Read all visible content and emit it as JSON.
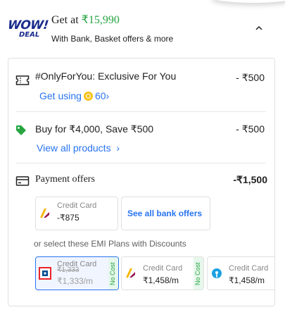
{
  "header": {
    "logo_wow": "WOW!",
    "logo_deal": "DEAL",
    "get_at_label": "Get at",
    "get_at_price": "₹15,990",
    "subtitle": "With Bank, Basket offers & more"
  },
  "offers": {
    "exclusive": {
      "title": "#OnlyForYou: Exclusive For You",
      "amount": "- ₹500",
      "link_label": "Get using",
      "coins": "60",
      "link_chevron": "›"
    },
    "basket": {
      "title": "Buy for ₹4,000, Save ₹500",
      "amount": "- ₹500",
      "link_label": "View all products",
      "link_chevron": "›"
    },
    "payment": {
      "title": "Payment offers",
      "amount": "-₹1,500",
      "bank_offer": {
        "type": "Credit Card",
        "value": "-₹875"
      },
      "see_all_label": "See all bank offers",
      "emi_hint": "or select these EMI Plans with Discounts",
      "emi_plans": [
        {
          "type": "Credit Card",
          "struck": "₹1,333",
          "value": "₹1,333/m",
          "badge": "No Cost",
          "selected": true
        },
        {
          "type": "Credit Card",
          "value": "₹1,458/m",
          "badge": "No Cost",
          "selected": false
        },
        {
          "type": "Credit Card",
          "value": "₹1,458/m",
          "selected": false
        }
      ]
    }
  },
  "colors": {
    "brand_blue": "#2874f0",
    "price_green": "#26a541",
    "logo_navy": "#1a2c8c"
  }
}
